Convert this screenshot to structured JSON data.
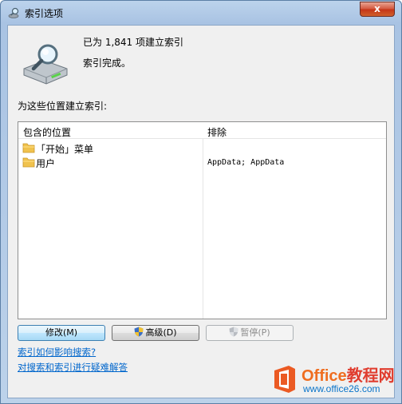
{
  "window": {
    "title": "索引选项",
    "close_label": "x"
  },
  "status": {
    "count_text": "已为 1,841 项建立索引",
    "state_text": "索引完成。"
  },
  "locations_label": "为这些位置建立索引:",
  "table": {
    "columns": [
      "包含的位置",
      "排除"
    ],
    "rows": [
      {
        "location": "「开始」菜单",
        "exclude": ""
      },
      {
        "location": "用户",
        "exclude": "AppData; AppData"
      }
    ]
  },
  "buttons": {
    "modify": "修改(M)",
    "advanced": "高级(D)",
    "pause": "暂停(P)"
  },
  "links": {
    "how_affects": "索引如何影响搜索?",
    "troubleshoot": "对搜索和索引进行疑难解答"
  },
  "watermark": {
    "title_latin": "Office",
    "title_cn": "教程网",
    "url": "www.office26.com"
  },
  "colors": {
    "link": "#0066cc",
    "close_button": "#c43317",
    "title_bar": "#a9c3e3"
  },
  "icons": [
    "search-index-icon",
    "hard-drive-magnifier-icon",
    "folder-icon",
    "uac-shield-icon",
    "office-logo-icon"
  ]
}
